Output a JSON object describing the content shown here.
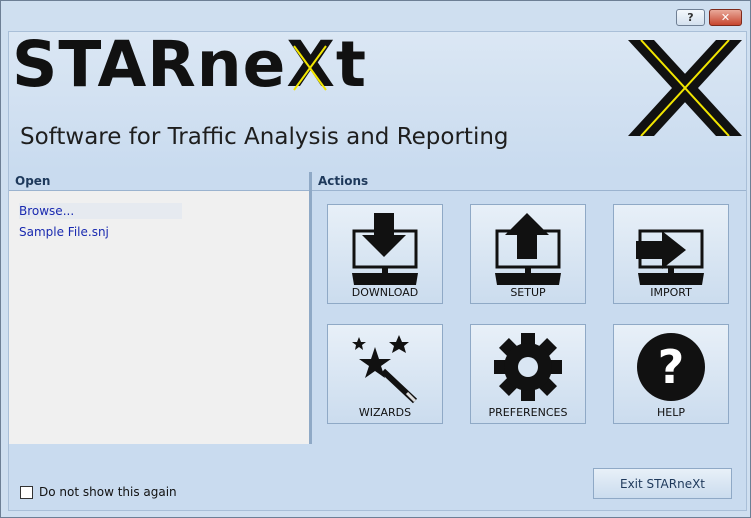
{
  "window": {
    "help_label": "?",
    "close_label": "✕"
  },
  "banner": {
    "logo_prefix": "STARne",
    "logo_x": "X",
    "logo_suffix": "t",
    "subtitle": "Software for Traffic Analysis and Reporting"
  },
  "open_panel": {
    "header": "Open",
    "items": [
      "Browse...",
      "Sample File.snj"
    ]
  },
  "actions_panel": {
    "header": "Actions",
    "buttons": [
      {
        "label": "DOWNLOAD",
        "icon": "download-icon"
      },
      {
        "label": "SETUP",
        "icon": "setup-upload-icon"
      },
      {
        "label": "IMPORT",
        "icon": "import-icon"
      },
      {
        "label": "WIZARDS",
        "icon": "magic-wand-icon"
      },
      {
        "label": "PREFERENCES",
        "icon": "gear-icon"
      },
      {
        "label": "HELP",
        "icon": "question-icon"
      }
    ]
  },
  "footer": {
    "checkbox_label": "Do not show this again",
    "exit_label": "Exit STARneXt"
  },
  "colors": {
    "accent_yellow": "#f2e600",
    "link_blue": "#1a2ab0"
  }
}
